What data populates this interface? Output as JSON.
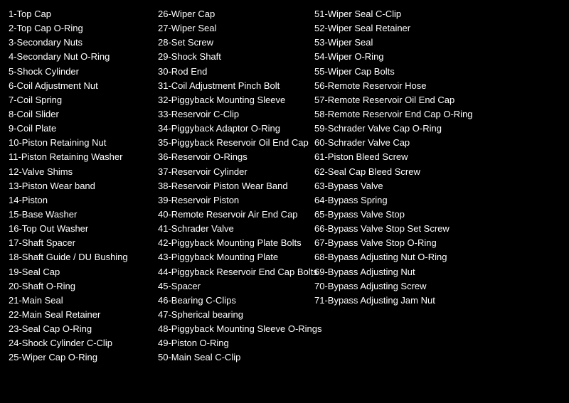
{
  "columns": [
    {
      "id": "col1",
      "items": [
        "1-Top Cap",
        "2-Top Cap O-Ring",
        "3-Secondary Nuts",
        "4-Secondary Nut O-Ring",
        "5-Shock Cylinder",
        "6-Coil Adjustment Nut",
        "7-Coil Spring",
        "8-Coil Slider",
        "9-Coil Plate",
        "10-Piston Retaining Nut",
        "11-Piston Retaining Washer",
        "12-Valve Shims",
        "13-Piston Wear band",
        "14-Piston",
        "15-Base Washer",
        "16-Top Out Washer",
        "17-Shaft Spacer",
        "18-Shaft Guide / DU Bushing",
        "19-Seal Cap",
        "20-Shaft O-Ring",
        "21-Main Seal",
        "22-Main Seal Retainer",
        "23-Seal Cap O-Ring",
        "24-Shock Cylinder C-Clip",
        "25-Wiper Cap O-Ring"
      ]
    },
    {
      "id": "col2",
      "items": [
        "26-Wiper Cap",
        "27-Wiper Seal",
        "28-Set Screw",
        "29-Shock Shaft",
        "30-Rod End",
        "31-Coil Adjustment Pinch Bolt",
        "32-Piggyback Mounting Sleeve",
        "33-Reservoir C-Clip",
        "34-Piggyback Adaptor O-Ring",
        "35-Piggyback Reservoir Oil End Cap",
        "36-Reservoir O-Rings",
        "37-Reservoir Cylinder",
        "38-Reservoir Piston Wear Band",
        "39-Reservoir Piston",
        "40-Remote Reservoir Air End Cap",
        "41-Schrader Valve",
        "42-Piggyback Mounting Plate Bolts",
        "43-Piggyback Mounting Plate",
        "44-Piggyback Reservoir End Cap Bolts",
        "45-Spacer",
        "46-Bearing C-Clips",
        "47-Spherical bearing",
        "48-Piggyback Mounting Sleeve O-Rings",
        "49-Piston O-Ring",
        "50-Main Seal C-Clip"
      ]
    },
    {
      "id": "col3",
      "items": [
        "51-Wiper Seal C-Clip",
        "52-Wiper Seal Retainer",
        "53-Wiper Seal",
        "54-Wiper O-Ring",
        "55-Wiper Cap Bolts",
        "56-Remote Reservoir Hose",
        "57-Remote Reservoir Oil End Cap",
        "58-Remote Reservoir End Cap O-Ring",
        "59-Schrader Valve Cap O-Ring",
        "60-Schrader Valve Cap",
        "61-Piston Bleed Screw",
        "62-Seal Cap Bleed Screw",
        "63-Bypass Valve",
        "64-Bypass Spring",
        "65-Bypass Valve Stop",
        "66-Bypass Valve Stop Set Screw",
        "67-Bypass Valve Stop O-Ring",
        "68-Bypass Adjusting Nut O-Ring",
        "69-Bypass Adjusting Nut",
        "70-Bypass Adjusting Screw",
        "71-Bypass Adjusting Jam Nut"
      ]
    }
  ]
}
